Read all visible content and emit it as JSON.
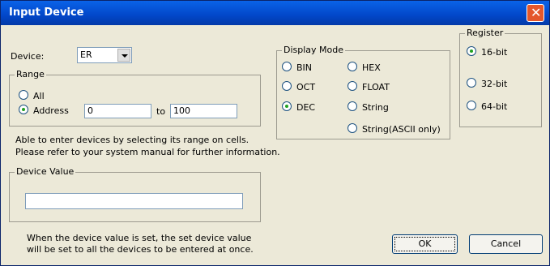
{
  "window": {
    "title": "Input Device"
  },
  "device": {
    "label": "Device:",
    "value": "ER"
  },
  "range": {
    "group_label": "Range",
    "all_label": "All",
    "address_label": "Address",
    "from_value": "0",
    "to_label": "to",
    "to_value": "100"
  },
  "info": {
    "line1": "Able to enter devices by selecting its range on cells.",
    "line2": "Please refer to your system manual for further information."
  },
  "device_value": {
    "group_label": "Device Value",
    "value": ""
  },
  "note": {
    "line1": "When the device value is set, the set device value",
    "line2": "will be set to all the devices to be entered at once."
  },
  "display_mode": {
    "group_label": "Display Mode",
    "options": [
      "BIN",
      "OCT",
      "DEC",
      "HEX",
      "FLOAT",
      "String",
      "String(ASCII only)"
    ],
    "selected": "DEC"
  },
  "register": {
    "group_label": "Register",
    "options": [
      "16-bit",
      "32-bit",
      "64-bit"
    ],
    "selected": "16-bit"
  },
  "buttons": {
    "ok": "OK",
    "cancel": "Cancel"
  },
  "icons": {
    "close": "close-icon",
    "dropdown": "chevron-down-icon"
  }
}
